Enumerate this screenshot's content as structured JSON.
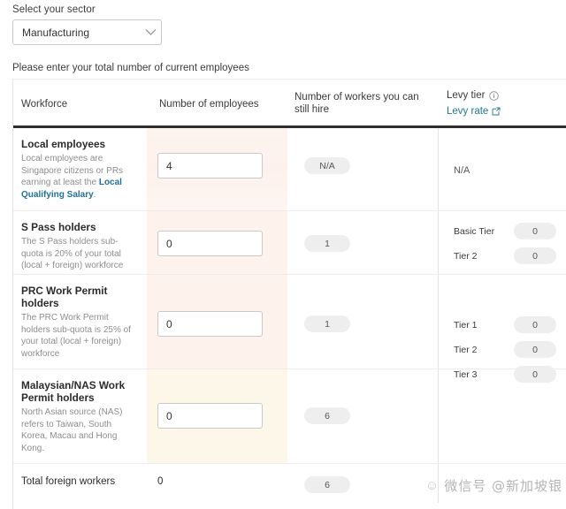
{
  "sector": {
    "label": "Select your sector",
    "selected": "Manufacturing",
    "chevron_icon": "chevron-down-icon"
  },
  "instruction": "Please enter your total number of current employees",
  "table": {
    "headers": {
      "workforce": "Workforce",
      "number_of_employees": "Number of employees",
      "workers_can_hire": "Number of workers you can still hire",
      "levy_tier": "Levy tier",
      "levy_rate": "Levy rate",
      "info_icon": "info-circle-icon",
      "external_link_icon": "external-link-icon"
    },
    "rows": [
      {
        "title": "Local employees",
        "desc_before": "Local employees are Singapore citizens or PRs earning at least the ",
        "desc_link": "Local Qualifying Salary",
        "desc_after": ".",
        "input_value": "4",
        "can_hire": "N/A",
        "levy": {
          "type": "text",
          "value": "N/A"
        }
      },
      {
        "title": "S Pass holders",
        "desc_before": "The S Pass holders sub-quota is 20% of your total (local + foreign) workforce",
        "desc_link": "",
        "desc_after": "",
        "input_value": "0",
        "can_hire": "1",
        "levy": {
          "type": "tiers",
          "tiers": [
            {
              "label": "Basic Tier",
              "value": "0"
            },
            {
              "label": "Tier 2",
              "value": "0"
            }
          ]
        }
      },
      {
        "title": "PRC Work Permit holders",
        "desc_before": "The PRC Work Permit holders sub-quota is 25% of your total (local + foreign) workforce",
        "desc_link": "",
        "desc_after": "",
        "input_value": "0",
        "can_hire": "1",
        "levy": {
          "type": "tiers",
          "tiers": [
            {
              "label": "Tier 1",
              "value": "0"
            },
            {
              "label": "Tier 2",
              "value": "0"
            },
            {
              "label": "Tier 3",
              "value": "0"
            }
          ]
        }
      },
      {
        "title": "Malaysian/NAS Work Permit holders",
        "desc_before": "North Asian source (NAS) refers to Taiwan, South Korea, Macau and Hong Kong.",
        "desc_link": "",
        "desc_after": "",
        "input_value": "0",
        "can_hire": "6",
        "levy": {
          "type": "none"
        }
      }
    ],
    "total": {
      "label": "Total foreign workers",
      "value": "0",
      "can_hire": "6"
    }
  },
  "watermark": {
    "icon": "wechat-icon",
    "text": "微信号 @新加坡银"
  },
  "colors": {
    "link": "#1f6f9c",
    "levy_link": "#1f7a8c",
    "header_rule": "#2e2e2e",
    "highlight_peach": "#fdf2ec",
    "highlight_cream": "#fdf7ea",
    "pill_bg": "#eeeeee"
  }
}
